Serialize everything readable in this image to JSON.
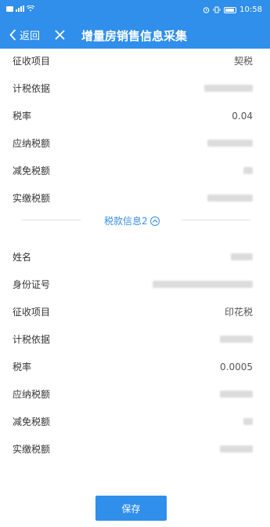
{
  "status_bar": {
    "time": "10:58"
  },
  "nav": {
    "back_label": "返回",
    "title": "增量房销售信息采集"
  },
  "section1": {
    "rows": [
      {
        "label": "征收项目",
        "value": "契税"
      },
      {
        "label": "计税依据",
        "value": ""
      },
      {
        "label": "税率",
        "value": "0.04"
      },
      {
        "label": "应纳税额",
        "value": ""
      },
      {
        "label": "减免税额",
        "value": ""
      },
      {
        "label": "实缴税额",
        "value": ""
      }
    ]
  },
  "section2_header": {
    "label": "税款信息2"
  },
  "section2": {
    "rows": [
      {
        "label": "姓名",
        "value": ""
      },
      {
        "label": "身份证号",
        "value": ""
      },
      {
        "label": "征收项目",
        "value": "印花税"
      },
      {
        "label": "计税依据",
        "value": ""
      },
      {
        "label": "税率",
        "value": "0.0005"
      },
      {
        "label": "应纳税额",
        "value": ""
      },
      {
        "label": "减免税额",
        "value": ""
      },
      {
        "label": "实缴税额",
        "value": ""
      }
    ]
  },
  "footer": {
    "save_label": "保存"
  },
  "colors": {
    "primary": "#2f8fea",
    "link": "#3b8fe0"
  },
  "icons": [
    "signal-icon",
    "wifi-icon",
    "alarm-icon",
    "vibrate-icon",
    "battery-icon",
    "back-chevron-icon",
    "close-icon",
    "chevron-up-circle-icon"
  ]
}
